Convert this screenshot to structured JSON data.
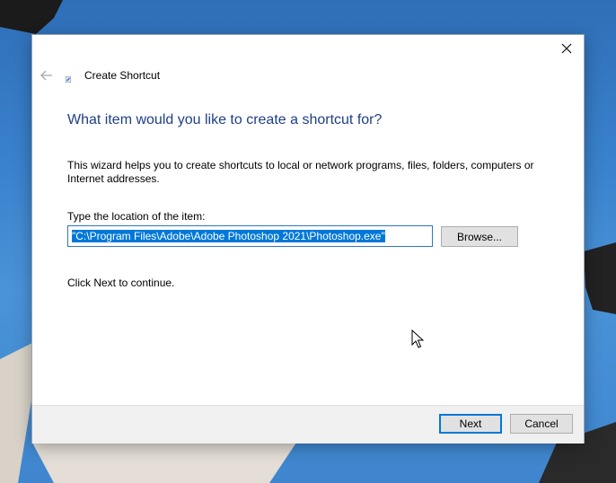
{
  "window": {
    "title": "Create Shortcut"
  },
  "wizard": {
    "heading": "What item would you like to create a shortcut for?",
    "description": "This wizard helps you to create shortcuts to local or network programs, files, folders, computers or Internet addresses.",
    "location_label": "Type the location of the item:",
    "location_value": "\"C:\\Program Files\\Adobe\\Adobe Photoshop 2021\\Photoshop.exe\"",
    "browse_label": "Browse...",
    "hint": "Click Next to continue."
  },
  "footer": {
    "next_label": "Next",
    "cancel_label": "Cancel"
  },
  "icons": {
    "close": "close-icon",
    "back": "back-arrow-icon",
    "shortcut": "shortcut-icon"
  },
  "colors": {
    "heading": "#1f3f86",
    "accent": "#0078d7",
    "footer_bg": "#f0f0f0"
  }
}
